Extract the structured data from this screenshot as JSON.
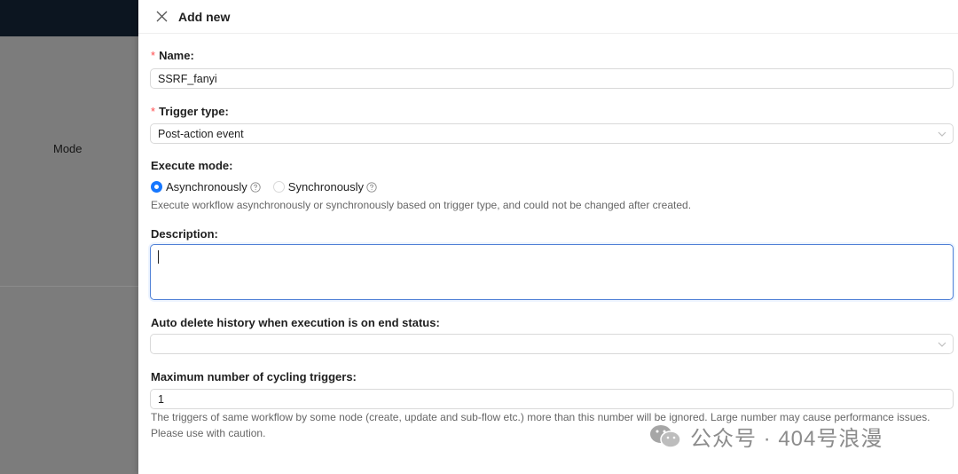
{
  "background": {
    "mode_label": "Mode"
  },
  "drawer": {
    "title": "Add new",
    "close_icon": "close-icon"
  },
  "form": {
    "name": {
      "label": "Name:",
      "value": "SSRF_fanyi",
      "required": true
    },
    "trigger_type": {
      "label": "Trigger type:",
      "value": "Post-action event",
      "required": true
    },
    "execute_mode": {
      "label": "Execute mode:",
      "options": [
        "Asynchronously",
        "Synchronously"
      ],
      "selected": "Asynchronously",
      "help": "Execute workflow asynchronously or synchronously based on trigger type, and could not be changed after created."
    },
    "description": {
      "label": "Description:",
      "value": ""
    },
    "auto_delete": {
      "label": "Auto delete history when execution is on end status:",
      "value": ""
    },
    "max_cycling": {
      "label": "Maximum number of cycling triggers:",
      "value": "1",
      "help_line1": "The triggers of same workflow by some node (create, update and sub-flow etc.) more than this number will be ignored. Large number may cause performance issues.",
      "help_line2": "Please use with caution."
    }
  },
  "watermark": {
    "text": "公众号 · 404号浪漫",
    "icon": "wechat-icon"
  },
  "colors": {
    "primary": "#1677ff",
    "required": "#ff4d4f",
    "topbar": "#0c1520",
    "overlay": "#7c7c7c"
  }
}
